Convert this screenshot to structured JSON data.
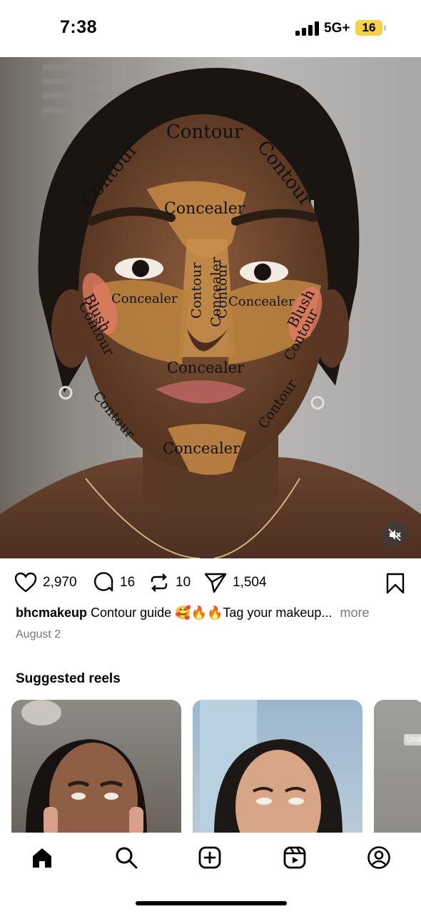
{
  "status_bar": {
    "time": "7:38",
    "network": "5G+",
    "battery": "16",
    "battery_color": "#f3d24a"
  },
  "video": {
    "labels": [
      "Contour",
      "Contour",
      "Contour",
      "Concealer",
      "Blush",
      "Contour",
      "Concealer",
      "Contour",
      "Concealer",
      "Contour",
      "Concealer",
      "Blush",
      "Contour",
      "Concealer",
      "Contour",
      "Contour",
      "Concealer"
    ],
    "mute_icon": "speaker-muted-icon"
  },
  "actions": {
    "likes": "2,970",
    "comments": "16",
    "reposts": "10",
    "shares": "1,504",
    "icons": [
      "heart-icon",
      "comment-icon",
      "repost-icon",
      "send-icon",
      "bookmark-icon"
    ]
  },
  "caption": {
    "username": "bhcmakeup",
    "text": "Contour guide 🥰🔥🔥Tag your makeup...",
    "more": "more",
    "date": "August 2"
  },
  "suggested": {
    "title": "Suggested reels",
    "peek_label": "Und"
  },
  "nav": {
    "items": [
      "home-icon",
      "search-icon",
      "create-icon",
      "reels-icon",
      "profile-icon"
    ]
  }
}
